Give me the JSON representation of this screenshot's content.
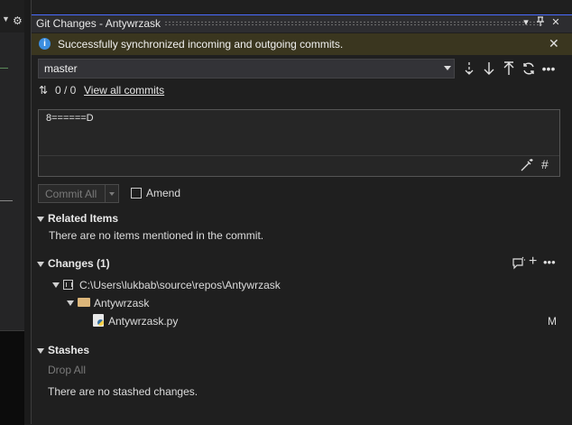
{
  "window": {
    "title": "Git Changes - Antywrzask",
    "buttons": {
      "dropdown": "▾",
      "pin": "⊥",
      "close": "✕"
    }
  },
  "notification": {
    "icon": "info-icon",
    "text": "Successfully synchronized incoming and outgoing commits.",
    "close": "✕"
  },
  "branch": {
    "name": "master",
    "actions": [
      "fetch-icon",
      "pull-icon",
      "push-icon",
      "sync-icon",
      "more-icon"
    ]
  },
  "sync": {
    "counts": "0 / 0",
    "view_all_link": "View all commits"
  },
  "commit": {
    "message": "8======D",
    "commit_button": "Commit All",
    "amend_label": "Amend"
  },
  "related_items": {
    "title": "Related Items",
    "empty_text": "There are no items mentioned in the commit."
  },
  "changes": {
    "title": "Changes (1)",
    "repo_path": "C:\\Users\\lukbab\\source\\repos\\Antywrzask",
    "folder": "Antywrzask",
    "file": {
      "name": "Antywrzask.py",
      "status": "M"
    }
  },
  "stashes": {
    "title": "Stashes",
    "drop_all": "Drop All",
    "empty_text": "There are no stashed changes."
  },
  "colors": {
    "background": "#1f1f1f",
    "info_bar": "#3a361f",
    "accent": "#4a6bff",
    "info_icon": "#3c8ee0"
  }
}
